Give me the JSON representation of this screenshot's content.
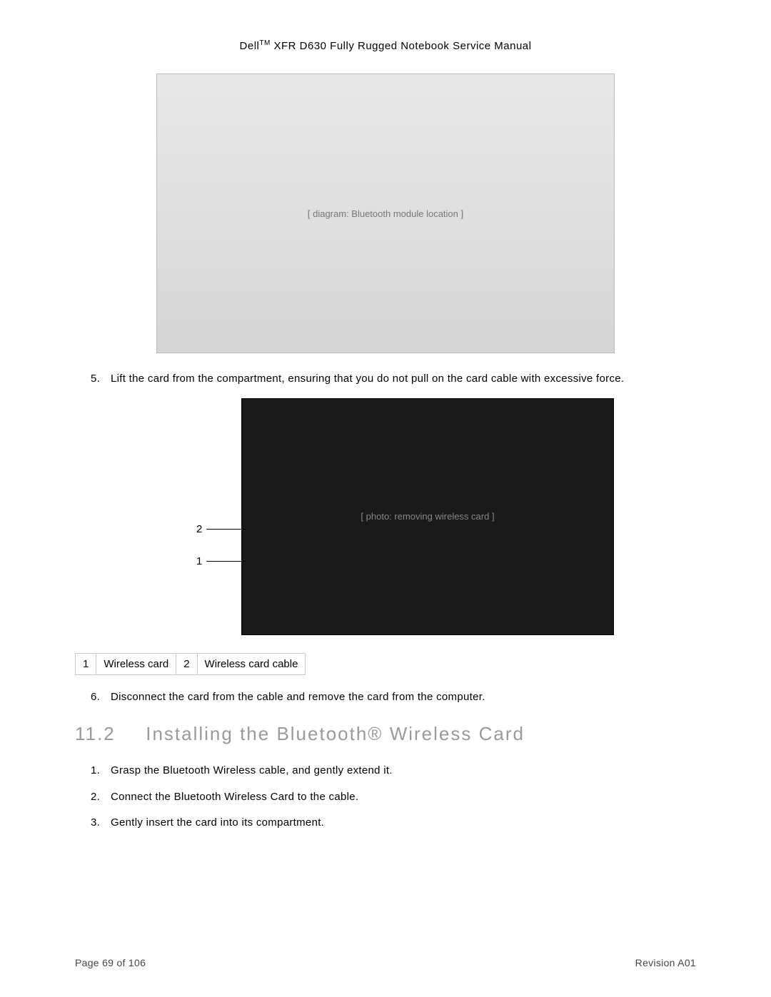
{
  "header": {
    "brand": "Dell",
    "tm": "TM",
    "rest": " XFR D630 Fully Rugged Notebook Service Manual"
  },
  "figure1_label": "[ diagram: Bluetooth module location ]",
  "step5": {
    "num": "5.",
    "text": "Lift the card from the compartment, ensuring that you do not pull on the card cable with excessive force."
  },
  "figure2_label": "[ photo: removing wireless card ]",
  "callouts": {
    "c1": "1",
    "c2": "2"
  },
  "legend": {
    "r1n": "1",
    "r1t": "Wireless card",
    "r2n": "2",
    "r2t": "Wireless card cable"
  },
  "step6": {
    "num": "6.",
    "text": "Disconnect the card from the cable and remove the card from the computer."
  },
  "section": {
    "num": "11.2",
    "title": "Installing the Bluetooth® Wireless Card"
  },
  "install_steps": [
    {
      "num": "1.",
      "text": "Grasp the Bluetooth Wireless cable, and gently extend it."
    },
    {
      "num": "2.",
      "text": "Connect the Bluetooth Wireless Card to the cable."
    },
    {
      "num": "3.",
      "text": "Gently insert the card into its compartment."
    }
  ],
  "footer": {
    "page": "Page 69 of 106",
    "rev": "Revision A01"
  }
}
